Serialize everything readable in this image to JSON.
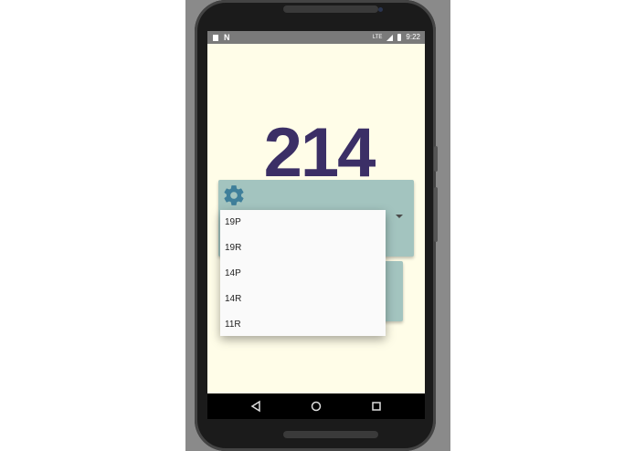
{
  "statusbar": {
    "time": "9:22",
    "network": "LTE"
  },
  "main": {
    "number": "214"
  },
  "dropdown": {
    "settings_icon": "gear-icon",
    "options": [
      "19P",
      "19R",
      "14P",
      "14R",
      "11R"
    ]
  },
  "navbar": {
    "back_icon": "back-icon",
    "home_icon": "home-icon",
    "recents_icon": "recents-icon"
  },
  "colors": {
    "background": "#fffde8",
    "card": "#a3c4bf",
    "number": "#3b2f66",
    "gear": "#3f7f9a"
  }
}
